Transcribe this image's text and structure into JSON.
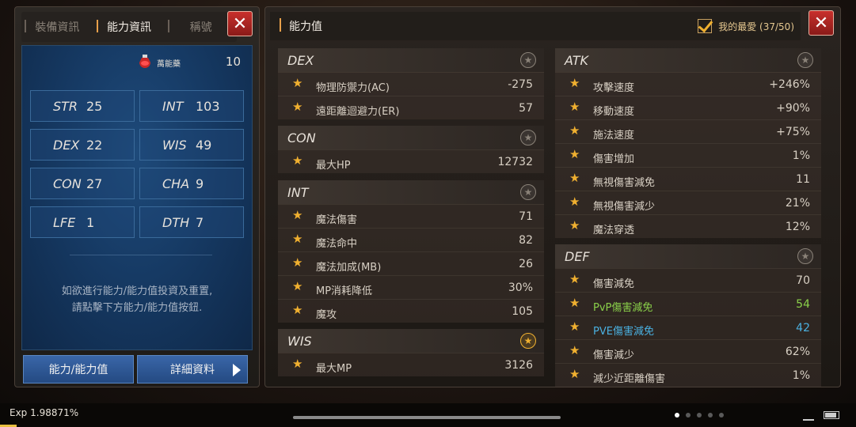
{
  "left_panel": {
    "tabs": [
      {
        "label": "裝備資訊",
        "active": false
      },
      {
        "label": "能力資訊",
        "active": true
      },
      {
        "label": "稱號",
        "active": false
      }
    ],
    "potion": {
      "icon": "potion-icon",
      "label": "萬能藥",
      "value": "10"
    },
    "stats": [
      {
        "name": "STR",
        "value": "25"
      },
      {
        "name": "INT",
        "value": "103"
      },
      {
        "name": "DEX",
        "value": "22"
      },
      {
        "name": "WIS",
        "value": "49"
      },
      {
        "name": "CON",
        "value": "27"
      },
      {
        "name": "CHA",
        "value": "9"
      },
      {
        "name": "LFE",
        "value": "1"
      },
      {
        "name": "DTH",
        "value": "7"
      }
    ],
    "info_line1": "如欲進行能力/能力值投資及重置,",
    "info_line2": "請點擊下方能力/能力值按鈕.",
    "btn_ability": "能力/能力值",
    "btn_detail": "詳細資料"
  },
  "right_panel": {
    "title": "能力值",
    "favorites_label": "我的最愛 (37/50)",
    "sections": {
      "dex": {
        "name": "DEX",
        "favorite": false,
        "rows": [
          {
            "label": "物理防禦力(AC)",
            "value": "-275"
          },
          {
            "label": "遠距離迴避力(ER)",
            "value": "57"
          }
        ]
      },
      "con": {
        "name": "CON",
        "favorite": false,
        "rows": [
          {
            "label": "最大HP",
            "value": "12732"
          }
        ]
      },
      "int": {
        "name": "INT",
        "favorite": false,
        "rows": [
          {
            "label": "魔法傷害",
            "value": "71"
          },
          {
            "label": "魔法命中",
            "value": "82"
          },
          {
            "label": "魔法加成(MB)",
            "value": "26"
          },
          {
            "label": "MP消耗降低",
            "value": "30%"
          },
          {
            "label": "魔攻",
            "value": "105"
          }
        ]
      },
      "wis": {
        "name": "WIS",
        "favorite": true,
        "rows": [
          {
            "label": "最大MP",
            "value": "3126"
          }
        ]
      },
      "atk": {
        "name": "ATK",
        "favorite": false,
        "rows": [
          {
            "label": "攻擊速度",
            "value": "+246%"
          },
          {
            "label": "移動速度",
            "value": "+90%"
          },
          {
            "label": "施法速度",
            "value": "+75%"
          },
          {
            "label": "傷害增加",
            "value": "1%"
          },
          {
            "label": "無視傷害減免",
            "value": "11"
          },
          {
            "label": "無視傷害減少",
            "value": "21%"
          },
          {
            "label": "魔法穿透",
            "value": "12%"
          }
        ]
      },
      "def": {
        "name": "DEF",
        "favorite": false,
        "rows": [
          {
            "label": "傷害減免",
            "value": "70",
            "color": ""
          },
          {
            "label": "PvP傷害減免",
            "value": "54",
            "color": "green"
          },
          {
            "label": "PVE傷害減免",
            "value": "42",
            "color": "cyan"
          },
          {
            "label": "傷害減少",
            "value": "62%",
            "color": ""
          },
          {
            "label": "減少近距離傷害",
            "value": "1%",
            "color": ""
          }
        ]
      }
    }
  },
  "bottom_bar": {
    "exp_text": "Exp 1.98871%",
    "exp_percent": 1.98871
  },
  "colors": {
    "accent_orange": "#e8a04a",
    "star_gold": "#f0b030",
    "close_red": "#c8302c",
    "button_blue": "#3a66a8",
    "pvp_green": "#8ad04a",
    "pve_cyan": "#4ab0e0"
  }
}
